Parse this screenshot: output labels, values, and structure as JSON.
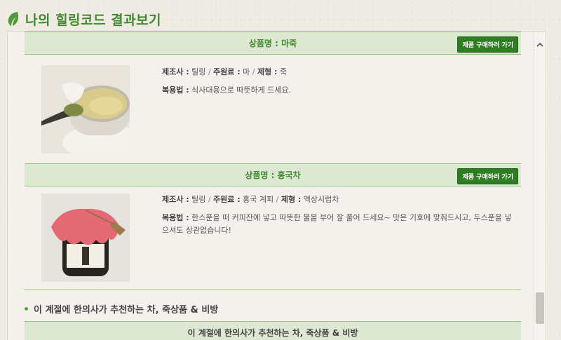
{
  "header": {
    "title": "나의 힐링코드 결과보기"
  },
  "products": [
    {
      "bar_title": "상품명 : 마죽",
      "buy_label": "제품 구매하러 가기",
      "maker_label": "제조사 :",
      "maker": "틸링",
      "ingredient_label": "주원료 :",
      "ingredient": "마",
      "type_label": "제형 :",
      "type": "죽",
      "usage_label": "복용법 :",
      "usage": "식사대용으로 따뜻하게 드세요."
    },
    {
      "bar_title": "상품명 : 홍국차",
      "buy_label": "제품 구매하러 가기",
      "maker_label": "제조사 :",
      "maker": "틸링",
      "ingredient_label": "주원료 :",
      "ingredient": "홍국 계피",
      "type_label": "제형 :",
      "type": "액상시럽차",
      "usage_label": "복용법 :",
      "usage": "한스푼을 떠 커피잔에 넣고 따뜻한 물을 부어 잘 풀어 드세요~ 맛은 기호에 맞춰드시고, 두스푼을 넣으셔도 상관없습니다!"
    }
  ],
  "section": {
    "title": "이 계절에 한의사가 추천하는 차, 죽상품 & 비방",
    "sub_title": "이 계절에 한의사가 추천하는 차, 죽상품 & 비방"
  },
  "colors": {
    "accent_green": "#3f8a2f",
    "button_green": "#2f7d22",
    "bar_bg": "#dde8d2"
  },
  "icons": {
    "header": "leaf-icon",
    "scroll": "chevron-up-icon"
  }
}
